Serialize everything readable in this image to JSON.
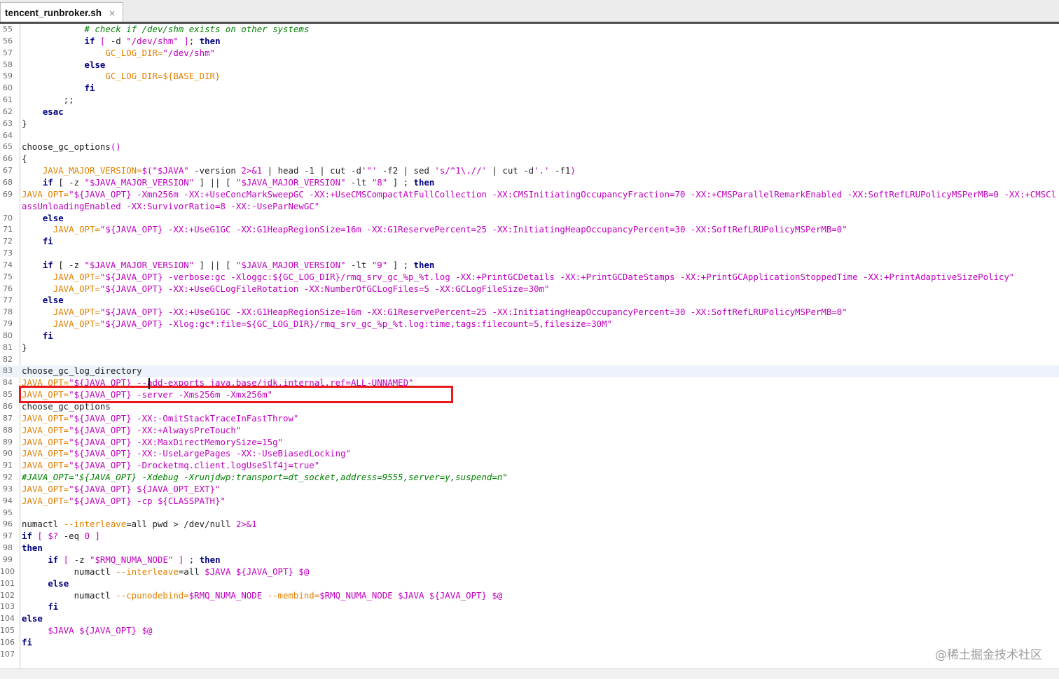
{
  "tab": {
    "title": "tencent_runbroker.sh",
    "close_glyph": "×"
  },
  "watermark": "@稀土掘金技术社区",
  "colors": {
    "keyword": "#00007f",
    "string": "#bf00bf",
    "variable": "#e08000",
    "comment": "#008000",
    "highlight_box": "#e8191b"
  },
  "lines": [
    {
      "n": "55",
      "segs": [
        {
          "c": "cmt",
          "t": "            # check if /dev/shm exists on other systems"
        }
      ]
    },
    {
      "n": "56",
      "segs": [
        {
          "c": "",
          "t": "            "
        },
        {
          "c": "kw",
          "t": "if"
        },
        {
          "c": "",
          "t": " "
        },
        {
          "c": "str",
          "t": "["
        },
        {
          "c": "",
          "t": " -d "
        },
        {
          "c": "str",
          "t": "\"/dev/shm\""
        },
        {
          "c": "",
          "t": " "
        },
        {
          "c": "str",
          "t": "]"
        },
        {
          "c": "",
          "t": "; "
        },
        {
          "c": "kw",
          "t": "then"
        }
      ]
    },
    {
      "n": "57",
      "segs": [
        {
          "c": "",
          "t": "                "
        },
        {
          "c": "var",
          "t": "GC_LOG_DIR="
        },
        {
          "c": "str",
          "t": "\"/dev/shm\""
        }
      ]
    },
    {
      "n": "58",
      "segs": [
        {
          "c": "",
          "t": "            "
        },
        {
          "c": "kw",
          "t": "else"
        }
      ]
    },
    {
      "n": "59",
      "segs": [
        {
          "c": "",
          "t": "                "
        },
        {
          "c": "var",
          "t": "GC_LOG_DIR=${BASE_DIR}"
        }
      ]
    },
    {
      "n": "60",
      "segs": [
        {
          "c": "",
          "t": "            "
        },
        {
          "c": "kw",
          "t": "fi"
        }
      ]
    },
    {
      "n": "61",
      "segs": [
        {
          "c": "",
          "t": "        ;;"
        }
      ]
    },
    {
      "n": "62",
      "segs": [
        {
          "c": "",
          "t": "    "
        },
        {
          "c": "kw",
          "t": "esac"
        }
      ]
    },
    {
      "n": "63",
      "segs": [
        {
          "c": "",
          "t": "}"
        }
      ]
    },
    {
      "n": "64",
      "segs": []
    },
    {
      "n": "65",
      "segs": [
        {
          "c": "",
          "t": "choose_gc_options"
        },
        {
          "c": "str",
          "t": "()"
        }
      ]
    },
    {
      "n": "66",
      "segs": [
        {
          "c": "",
          "t": "{"
        }
      ]
    },
    {
      "n": "67",
      "segs": [
        {
          "c": "",
          "t": "    "
        },
        {
          "c": "var",
          "t": "JAVA_MAJOR_VERSION="
        },
        {
          "c": "str",
          "t": "$("
        },
        {
          "c": "str",
          "t": "\"$JAVA\""
        },
        {
          "c": "",
          "t": " -version "
        },
        {
          "c": "str",
          "t": "2>&1"
        },
        {
          "c": "",
          "t": " | head -1 | cut -d"
        },
        {
          "c": "str",
          "t": "'\"'"
        },
        {
          "c": "",
          "t": " -f2 | sed "
        },
        {
          "c": "str",
          "t": "'s/^1\\.//'"
        },
        {
          "c": "",
          "t": " | cut -d"
        },
        {
          "c": "str",
          "t": "'.'"
        },
        {
          "c": "",
          "t": " -f1"
        },
        {
          "c": "str",
          "t": ")"
        }
      ]
    },
    {
      "n": "68",
      "segs": [
        {
          "c": "",
          "t": "    "
        },
        {
          "c": "kw",
          "t": "if"
        },
        {
          "c": "",
          "t": " [ -z "
        },
        {
          "c": "str",
          "t": "\"$JAVA_MAJOR_VERSION\""
        },
        {
          "c": "",
          "t": " ] || [ "
        },
        {
          "c": "str",
          "t": "\"$JAVA_MAJOR_VERSION\""
        },
        {
          "c": "",
          "t": " -lt "
        },
        {
          "c": "str",
          "t": "\"8\""
        },
        {
          "c": "",
          "t": " ] ; "
        },
        {
          "c": "kw",
          "t": "then"
        }
      ]
    },
    {
      "n": "69",
      "wrap": true,
      "segs": [
        {
          "c": "",
          "t": "      "
        },
        {
          "c": "var",
          "t": "JAVA_OPT="
        },
        {
          "c": "str",
          "t": "\"${JAVA_OPT} -Xmn256m -XX:+UseConcMarkSweepGC -XX:+UseCMSCompactAtFullCollection -XX:CMSInitiatingOccupancyFraction=70 -XX:+CMSParallelRemarkEnabled -XX:SoftRefLRUPolicyMSPerMB=0 -XX:+CMSClassUnloadingEnabled -XX:SurvivorRatio=8 -XX:-UseParNewGC\""
        }
      ]
    },
    {
      "n": "70",
      "segs": [
        {
          "c": "",
          "t": "    "
        },
        {
          "c": "kw",
          "t": "else"
        }
      ]
    },
    {
      "n": "71",
      "segs": [
        {
          "c": "",
          "t": "      "
        },
        {
          "c": "var",
          "t": "JAVA_OPT="
        },
        {
          "c": "str",
          "t": "\"${JAVA_OPT} -XX:+UseG1GC -XX:G1HeapRegionSize=16m -XX:G1ReservePercent=25 -XX:InitiatingHeapOccupancyPercent=30 -XX:SoftRefLRUPolicyMSPerMB=0\""
        }
      ]
    },
    {
      "n": "72",
      "segs": [
        {
          "c": "",
          "t": "    "
        },
        {
          "c": "kw",
          "t": "fi"
        }
      ]
    },
    {
      "n": "73",
      "segs": []
    },
    {
      "n": "74",
      "segs": [
        {
          "c": "",
          "t": "    "
        },
        {
          "c": "kw",
          "t": "if"
        },
        {
          "c": "",
          "t": " [ -z "
        },
        {
          "c": "str",
          "t": "\"$JAVA_MAJOR_VERSION\""
        },
        {
          "c": "",
          "t": " ] || [ "
        },
        {
          "c": "str",
          "t": "\"$JAVA_MAJOR_VERSION\""
        },
        {
          "c": "",
          "t": " -lt "
        },
        {
          "c": "str",
          "t": "\"9\""
        },
        {
          "c": "",
          "t": " ] ; "
        },
        {
          "c": "kw",
          "t": "then"
        }
      ]
    },
    {
      "n": "75",
      "segs": [
        {
          "c": "",
          "t": "      "
        },
        {
          "c": "var",
          "t": "JAVA_OPT="
        },
        {
          "c": "str",
          "t": "\"${JAVA_OPT} -verbose:gc -Xloggc:${GC_LOG_DIR}/rmq_srv_gc_%p_%t.log -XX:+PrintGCDetails -XX:+PrintGCDateStamps -XX:+PrintGCApplicationStoppedTime -XX:+PrintAdaptiveSizePolicy\""
        }
      ]
    },
    {
      "n": "76",
      "segs": [
        {
          "c": "",
          "t": "      "
        },
        {
          "c": "var",
          "t": "JAVA_OPT="
        },
        {
          "c": "str",
          "t": "\"${JAVA_OPT} -XX:+UseGCLogFileRotation -XX:NumberOfGCLogFiles=5 -XX:GCLogFileSize=30m\""
        }
      ]
    },
    {
      "n": "77",
      "segs": [
        {
          "c": "",
          "t": "    "
        },
        {
          "c": "kw",
          "t": "else"
        }
      ]
    },
    {
      "n": "78",
      "segs": [
        {
          "c": "",
          "t": "      "
        },
        {
          "c": "var",
          "t": "JAVA_OPT="
        },
        {
          "c": "str",
          "t": "\"${JAVA_OPT} -XX:+UseG1GC -XX:G1HeapRegionSize=16m -XX:G1ReservePercent=25 -XX:InitiatingHeapOccupancyPercent=30 -XX:SoftRefLRUPolicyMSPerMB=0\""
        }
      ]
    },
    {
      "n": "79",
      "segs": [
        {
          "c": "",
          "t": "      "
        },
        {
          "c": "var",
          "t": "JAVA_OPT="
        },
        {
          "c": "str",
          "t": "\"${JAVA_OPT} -Xlog:gc*:file=${GC_LOG_DIR}/rmq_srv_gc_%p_%t.log:time,tags:filecount=5,filesize=30M\""
        }
      ]
    },
    {
      "n": "80",
      "segs": [
        {
          "c": "",
          "t": "    "
        },
        {
          "c": "kw",
          "t": "fi"
        }
      ]
    },
    {
      "n": "81",
      "segs": [
        {
          "c": "",
          "t": "}"
        }
      ]
    },
    {
      "n": "82",
      "segs": []
    },
    {
      "n": "83",
      "current": true,
      "segs": [
        {
          "c": "",
          "t": "choose_gc_log_directory"
        }
      ]
    },
    {
      "n": "84",
      "segs": [
        {
          "c": "var",
          "t": "JAVA_OPT="
        },
        {
          "c": "str",
          "t": "\"${JAVA_OPT} --add-exports java.base/jdk.internal.ref=ALL-UNNAMED\""
        }
      ]
    },
    {
      "n": "85",
      "segs": [
        {
          "c": "var",
          "t": "JAVA_OPT="
        },
        {
          "c": "str",
          "t": "\"${JAVA_OPT} -server -Xms256m -Xmx256m\""
        }
      ]
    },
    {
      "n": "86",
      "segs": [
        {
          "c": "",
          "t": "choose_gc_options"
        }
      ]
    },
    {
      "n": "87",
      "segs": [
        {
          "c": "var",
          "t": "JAVA_OPT="
        },
        {
          "c": "str",
          "t": "\"${JAVA_OPT} -XX:-OmitStackTraceInFastThrow\""
        }
      ]
    },
    {
      "n": "88",
      "segs": [
        {
          "c": "var",
          "t": "JAVA_OPT="
        },
        {
          "c": "str",
          "t": "\"${JAVA_OPT} -XX:+AlwaysPreTouch\""
        }
      ]
    },
    {
      "n": "89",
      "segs": [
        {
          "c": "var",
          "t": "JAVA_OPT="
        },
        {
          "c": "str",
          "t": "\"${JAVA_OPT} -XX:MaxDirectMemorySize=15g\""
        }
      ]
    },
    {
      "n": "90",
      "segs": [
        {
          "c": "var",
          "t": "JAVA_OPT="
        },
        {
          "c": "str",
          "t": "\"${JAVA_OPT} -XX:-UseLargePages -XX:-UseBiasedLocking\""
        }
      ]
    },
    {
      "n": "91",
      "segs": [
        {
          "c": "var",
          "t": "JAVA_OPT="
        },
        {
          "c": "str",
          "t": "\"${JAVA_OPT} -Drocketmq.client.logUseSlf4j=true\""
        }
      ]
    },
    {
      "n": "92",
      "segs": [
        {
          "c": "cmt",
          "t": "#JAVA_OPT=\"${JAVA_OPT} -Xdebug -Xrunjdwp:transport=dt_socket,address=9555,server=y,suspend=n\""
        }
      ]
    },
    {
      "n": "93",
      "segs": [
        {
          "c": "var",
          "t": "JAVA_OPT="
        },
        {
          "c": "str",
          "t": "\"${JAVA_OPT} ${JAVA_OPT_EXT}\""
        }
      ]
    },
    {
      "n": "94",
      "segs": [
        {
          "c": "var",
          "t": "JAVA_OPT="
        },
        {
          "c": "str",
          "t": "\"${JAVA_OPT} -cp ${CLASSPATH}\""
        }
      ]
    },
    {
      "n": "95",
      "segs": []
    },
    {
      "n": "96",
      "segs": [
        {
          "c": "",
          "t": "numactl "
        },
        {
          "c": "var",
          "t": "--interleave"
        },
        {
          "c": "",
          "t": "=all pwd > /dev/null "
        },
        {
          "c": "str",
          "t": "2>&1"
        }
      ]
    },
    {
      "n": "97",
      "segs": [
        {
          "c": "kw",
          "t": "if"
        },
        {
          "c": "",
          "t": " "
        },
        {
          "c": "str",
          "t": "["
        },
        {
          "c": "",
          "t": " "
        },
        {
          "c": "str",
          "t": "$?"
        },
        {
          "c": "",
          "t": " -eq "
        },
        {
          "c": "str",
          "t": "0"
        },
        {
          "c": "",
          "t": " "
        },
        {
          "c": "str",
          "t": "]"
        }
      ]
    },
    {
      "n": "98",
      "segs": [
        {
          "c": "kw",
          "t": "then"
        }
      ]
    },
    {
      "n": "99",
      "segs": [
        {
          "c": "",
          "t": "     "
        },
        {
          "c": "kw",
          "t": "if"
        },
        {
          "c": "",
          "t": " "
        },
        {
          "c": "str",
          "t": "["
        },
        {
          "c": "",
          "t": " -z "
        },
        {
          "c": "str",
          "t": "\"$RMQ_NUMA_NODE\""
        },
        {
          "c": "",
          "t": " "
        },
        {
          "c": "str",
          "t": "]"
        },
        {
          "c": "",
          "t": " ; "
        },
        {
          "c": "kw",
          "t": "then"
        }
      ]
    },
    {
      "n": "100",
      "segs": [
        {
          "c": "",
          "t": "          numactl "
        },
        {
          "c": "var",
          "t": "--interleave"
        },
        {
          "c": "",
          "t": "=all "
        },
        {
          "c": "str",
          "t": "$JAVA ${JAVA_OPT} $@"
        }
      ]
    },
    {
      "n": "101",
      "segs": [
        {
          "c": "",
          "t": "     "
        },
        {
          "c": "kw",
          "t": "else"
        }
      ]
    },
    {
      "n": "102",
      "segs": [
        {
          "c": "",
          "t": "          numactl "
        },
        {
          "c": "var",
          "t": "--cpunodebind="
        },
        {
          "c": "str",
          "t": "$RMQ_NUMA_NODE"
        },
        {
          "c": "",
          "t": " "
        },
        {
          "c": "var",
          "t": "--membind="
        },
        {
          "c": "str",
          "t": "$RMQ_NUMA_NODE $JAVA ${JAVA_OPT} $@"
        }
      ]
    },
    {
      "n": "103",
      "segs": [
        {
          "c": "",
          "t": "     "
        },
        {
          "c": "kw",
          "t": "fi"
        }
      ]
    },
    {
      "n": "104",
      "segs": [
        {
          "c": "kw",
          "t": "else"
        }
      ]
    },
    {
      "n": "105",
      "segs": [
        {
          "c": "",
          "t": "     "
        },
        {
          "c": "str",
          "t": "$JAVA ${JAVA_OPT} $@"
        }
      ]
    },
    {
      "n": "106",
      "segs": [
        {
          "c": "kw",
          "t": "fi"
        }
      ]
    },
    {
      "n": "107",
      "segs": []
    }
  ]
}
